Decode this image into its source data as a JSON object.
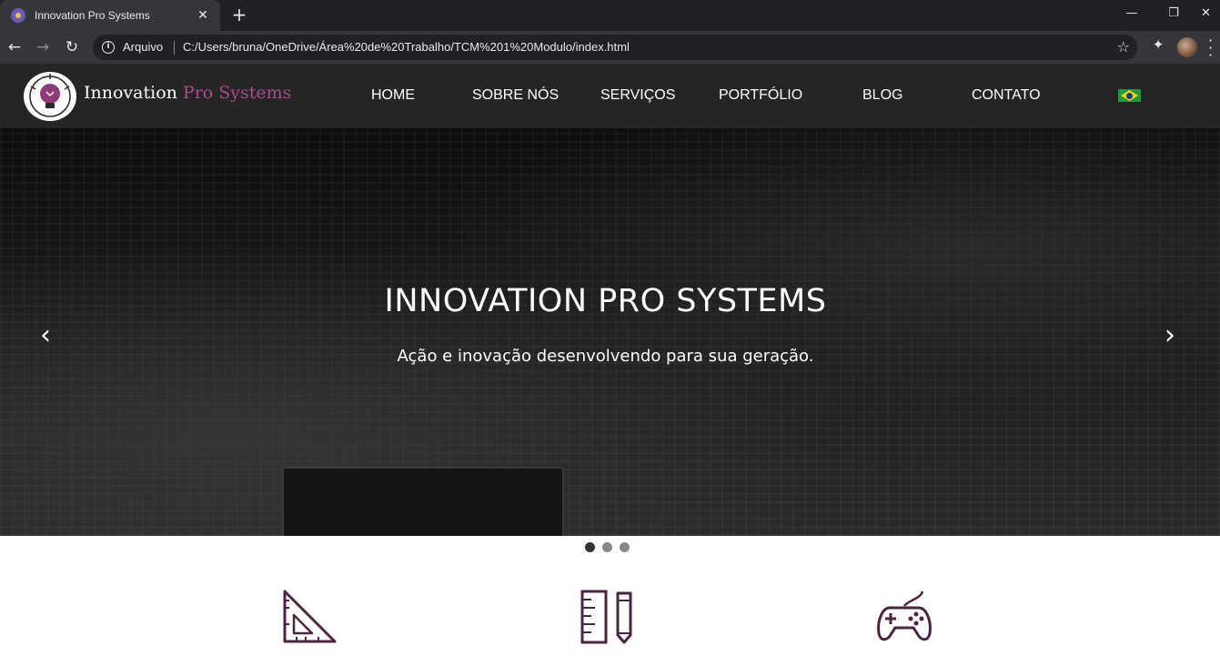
{
  "browser": {
    "tab_title": "Innovation Pro Systems",
    "origin_label": "Arquivo",
    "url": "C:/Users/bruna/OneDrive/Área%20de%20Trabalho/TCM%201%20Modulo/index.html"
  },
  "icons": {
    "tab_close": "✕",
    "new_tab": "+",
    "minimize": "—",
    "maximize": "❐",
    "close": "✕",
    "back": "←",
    "forward": "→",
    "reload": "↻",
    "star": "☆",
    "extensions": "✦",
    "carousel_prev": "‹",
    "carousel_next": "›"
  },
  "site": {
    "brand_part1": "Innovation ",
    "brand_part2": "Pro Systems",
    "nav": [
      "HOME",
      "SOBRE NÓS",
      "SERVIÇOS",
      "PORTFÓLIO",
      "BLOG",
      "CONTATO"
    ]
  },
  "hero": {
    "title": "INNOVATION PRO SYSTEMS",
    "subtitle": "Ação e inovação desenvolvendo para sua geração.",
    "slide_count": 3,
    "active_slide": 1
  },
  "features": {
    "icons": [
      "set-square-icon",
      "ruler-pencil-icon",
      "gamepad-icon"
    ]
  },
  "colors": {
    "header_bg": "#262424",
    "brand_accent": "#a64d8e",
    "icon_color": "#4a2540"
  }
}
